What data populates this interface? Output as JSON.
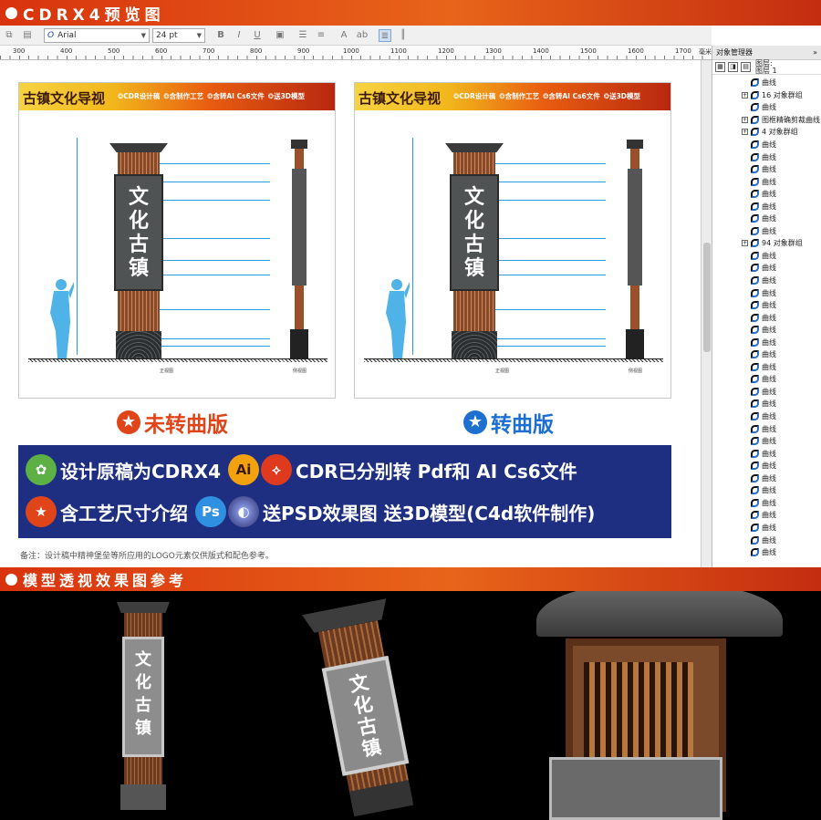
{
  "header": {
    "title": "CDRX4预览图"
  },
  "toolbar": {
    "font": "Arial",
    "size": "24 pt"
  },
  "ruler": {
    "marks": [
      "300",
      "400",
      "500",
      "600",
      "700",
      "800",
      "900",
      "1000",
      "1100",
      "1200",
      "1300",
      "1400",
      "1500",
      "1600",
      "1700",
      "毫米"
    ]
  },
  "panel": {
    "title": "对象管理器",
    "layer_label": "图层:",
    "layer_name": "图层 1",
    "items": [
      {
        "label": "曲线",
        "kind": "curve"
      },
      {
        "label": "16 对象群组",
        "kind": "group"
      },
      {
        "label": "曲线",
        "kind": "curve"
      },
      {
        "label": "图框精确剪裁曲线",
        "kind": "group"
      },
      {
        "label": "4 对象群组",
        "kind": "group"
      },
      {
        "label": "曲线",
        "kind": "curve"
      },
      {
        "label": "曲线",
        "kind": "curve"
      },
      {
        "label": "曲线",
        "kind": "curve"
      },
      {
        "label": "曲线",
        "kind": "curve"
      },
      {
        "label": "曲线",
        "kind": "curve"
      },
      {
        "label": "曲线",
        "kind": "curve"
      },
      {
        "label": "曲线",
        "kind": "curve"
      },
      {
        "label": "曲线",
        "kind": "curve"
      },
      {
        "label": "94 对象群组",
        "kind": "group"
      },
      {
        "label": "曲线",
        "kind": "curve"
      },
      {
        "label": "曲线",
        "kind": "curve"
      },
      {
        "label": "曲线",
        "kind": "curve"
      },
      {
        "label": "曲线",
        "kind": "curve"
      },
      {
        "label": "曲线",
        "kind": "curve"
      },
      {
        "label": "曲线",
        "kind": "curve"
      },
      {
        "label": "曲线",
        "kind": "curve"
      },
      {
        "label": "曲线",
        "kind": "curve"
      },
      {
        "label": "曲线",
        "kind": "curve"
      },
      {
        "label": "曲线",
        "kind": "curve"
      },
      {
        "label": "曲线",
        "kind": "curve"
      },
      {
        "label": "曲线",
        "kind": "curve"
      },
      {
        "label": "曲线",
        "kind": "curve"
      },
      {
        "label": "曲线",
        "kind": "curve"
      },
      {
        "label": "曲线",
        "kind": "curve"
      },
      {
        "label": "曲线",
        "kind": "curve"
      },
      {
        "label": "曲线",
        "kind": "curve"
      },
      {
        "label": "曲线",
        "kind": "curve"
      },
      {
        "label": "曲线",
        "kind": "curve"
      },
      {
        "label": "曲线",
        "kind": "curve"
      },
      {
        "label": "曲线",
        "kind": "curve"
      },
      {
        "label": "曲线",
        "kind": "curve"
      },
      {
        "label": "曲线",
        "kind": "curve"
      },
      {
        "label": "曲线",
        "kind": "curve"
      },
      {
        "label": "曲线",
        "kind": "curve"
      }
    ]
  },
  "boards": [
    {
      "title": "古镇文化导视",
      "tags": [
        "❂CDR设计稿",
        "❂含制作工艺",
        "❂含转AI Cs6文件",
        "❂送3D模型"
      ],
      "sign_text": "文化古镇",
      "front_caption": "正视图",
      "side_caption": "侧视图"
    },
    {
      "title": "古镇文化导视",
      "tags": [
        "❂CDR设计稿",
        "❂含制作工艺",
        "❂含转AI Cs6文件",
        "❂送3D模型"
      ],
      "sign_text": "文化古镇",
      "front_caption": "正视图",
      "side_caption": "侧视图"
    }
  ],
  "versions": {
    "left": "未转曲版",
    "right": "转曲版"
  },
  "banner": {
    "ai_icon": "Ai",
    "ps_icon": "Ps",
    "line1a": "设计原稿为CDRX4",
    "line1b": "CDR已分别转 Pdf和 AI Cs6文件",
    "line2a": "含工艺尺寸介绍",
    "line2b": "送PSD效果图 送3D模型(C4d软件制作)"
  },
  "note": "备注：设计稿中精神堡垒等所应用的LOGO元素仅供版式和配色参考。",
  "section2": {
    "title": "模型透视效果图参考"
  },
  "render_sign_text": "文化古镇",
  "colors": {
    "accent": "#e0451a",
    "banner": "#1e2f82",
    "dimension": "#2b9be0"
  }
}
